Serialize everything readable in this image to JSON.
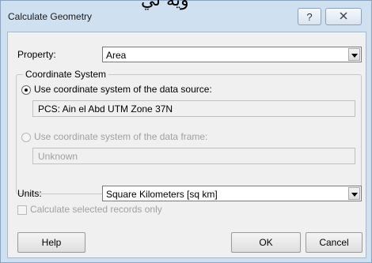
{
  "background_text": "وية لي",
  "window": {
    "title": "Calculate Geometry",
    "help_icon": "question-mark-icon",
    "close_icon": "close-icon"
  },
  "property": {
    "label": "Property:",
    "value": "Area"
  },
  "coordinate_system": {
    "legend": "Coordinate System",
    "data_source_option": {
      "label": "Use coordinate system of the data source:",
      "selected": true,
      "value": "PCS: Ain el Abd UTM Zone 37N"
    },
    "data_frame_option": {
      "label": "Use coordinate system of the data frame:",
      "selected": false,
      "enabled": false,
      "value": "Unknown"
    }
  },
  "units": {
    "label": "Units:",
    "value": "Square Kilometers [sq km]"
  },
  "selected_only": {
    "label": "Calculate selected records only",
    "checked": false,
    "enabled": false
  },
  "buttons": {
    "help": "Help",
    "ok": "OK",
    "cancel": "Cancel"
  },
  "colors": {
    "frame": "#cfe0f1",
    "client": "#f0f0f0",
    "disabled_text": "#a0a0a0"
  }
}
